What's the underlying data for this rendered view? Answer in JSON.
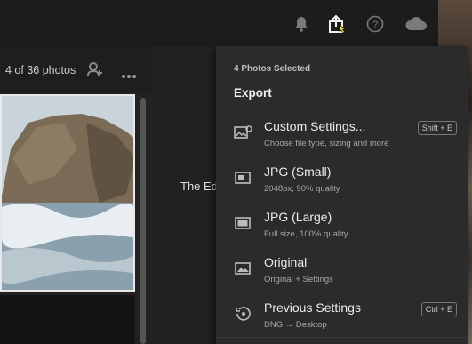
{
  "topbar": {
    "icons": [
      "bell-icon",
      "share-icon",
      "help-icon",
      "cloud-icon"
    ]
  },
  "grid": {
    "count_label": "4 of 36 photos"
  },
  "center": {
    "truncated_text": "The Ed"
  },
  "menu": {
    "selection_label": "4 Photos Selected",
    "title": "Export",
    "items": [
      {
        "label": "Custom Settings...",
        "sub": "Choose file type, sizing and more",
        "shortcut": "Shift + E",
        "icon": "custom-settings-icon"
      },
      {
        "label": "JPG (Small)",
        "sub": "2048px, 90% quality",
        "shortcut": "",
        "icon": "jpg-small-icon"
      },
      {
        "label": "JPG (Large)",
        "sub": "Full size, 100% quality",
        "shortcut": "",
        "icon": "jpg-large-icon"
      },
      {
        "label": "Original",
        "sub": "Original + Settings",
        "shortcut": "",
        "icon": "original-icon"
      },
      {
        "label": "Previous Settings",
        "sub": "DNG → Desktop",
        "shortcut": "Ctrl + E",
        "icon": "previous-settings-icon"
      }
    ]
  }
}
